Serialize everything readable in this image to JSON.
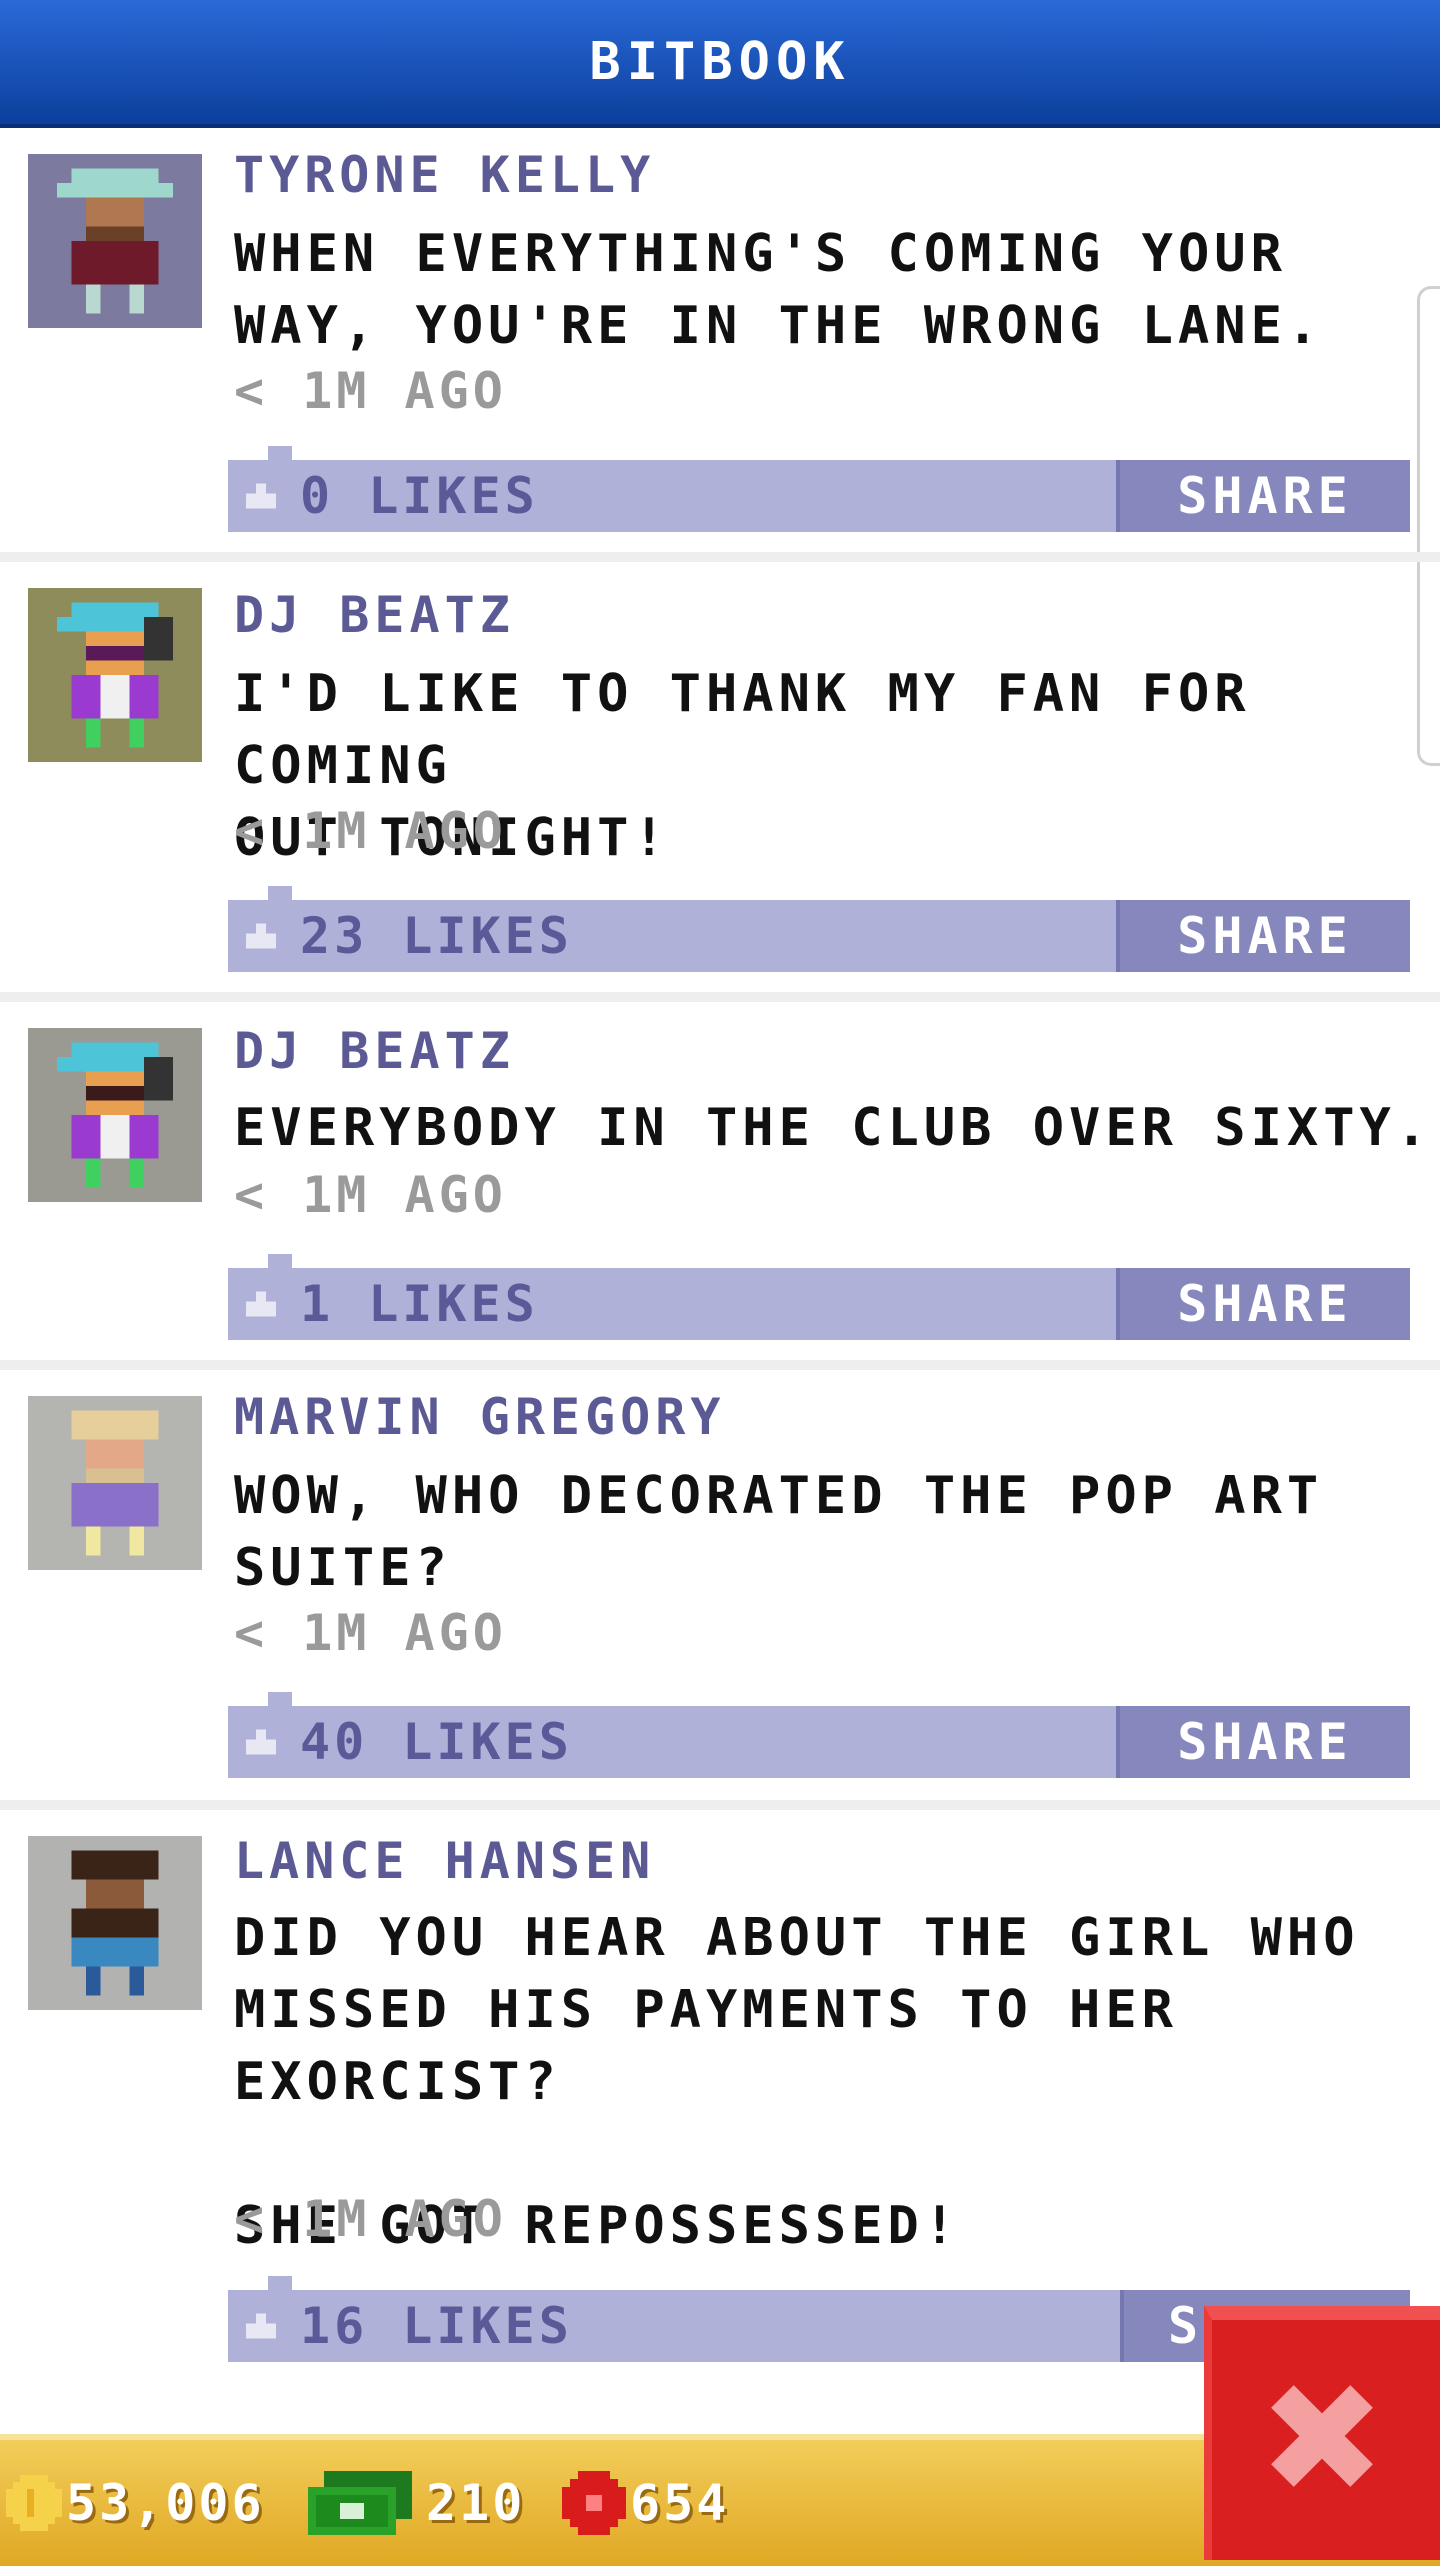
{
  "app": {
    "title": "BITBOOK"
  },
  "posts": [
    {
      "name": "TYRONE KELLY",
      "text": "WHEN EVERYTHING'S COMING YOUR\nWAY, YOU'RE IN THE WRONG LANE.",
      "time": "< 1M AGO",
      "likes": "0 LIKES",
      "share": "SHARE"
    },
    {
      "name": "DJ BEATZ",
      "text": "I'D LIKE TO THANK MY FAN FOR COMING\nOUT TONIGHT!",
      "time": "< 1M AGO",
      "likes": "23 LIKES",
      "share": "SHARE"
    },
    {
      "name": "DJ BEATZ",
      "text": "EVERYBODY IN THE CLUB OVER SIXTY.",
      "time": "< 1M AGO",
      "likes": "1 LIKES",
      "share": "SHARE"
    },
    {
      "name": "MARVIN GREGORY",
      "text": "WOW, WHO DECORATED THE POP ART\nSUITE?",
      "time": "< 1M AGO",
      "likes": "40 LIKES",
      "share": "SHARE"
    },
    {
      "name": "LANCE HANSEN",
      "text": "DID YOU HEAR ABOUT THE GIRL WHO\nMISSED HIS PAYMENTS TO HER\nEXORCIST?\n\nSHE GOT REPOSSESSED!",
      "time": "< 1M AGO",
      "likes": "16 LIKES",
      "share": "S"
    }
  ],
  "status": {
    "coins": "53,006",
    "bux": "210",
    "tokens": "654"
  },
  "icons": {
    "thumb": "thumbs-up-icon",
    "coin": "coin-icon",
    "bux": "bux-icon",
    "token": "token-icon",
    "close": "close-icon"
  },
  "colors": {
    "header": "#1c55c4",
    "like_bar": "#b0b1d8",
    "share_button": "#8688bd",
    "bottom_bar": "#e8b838",
    "close_button": "#d91f1f"
  }
}
